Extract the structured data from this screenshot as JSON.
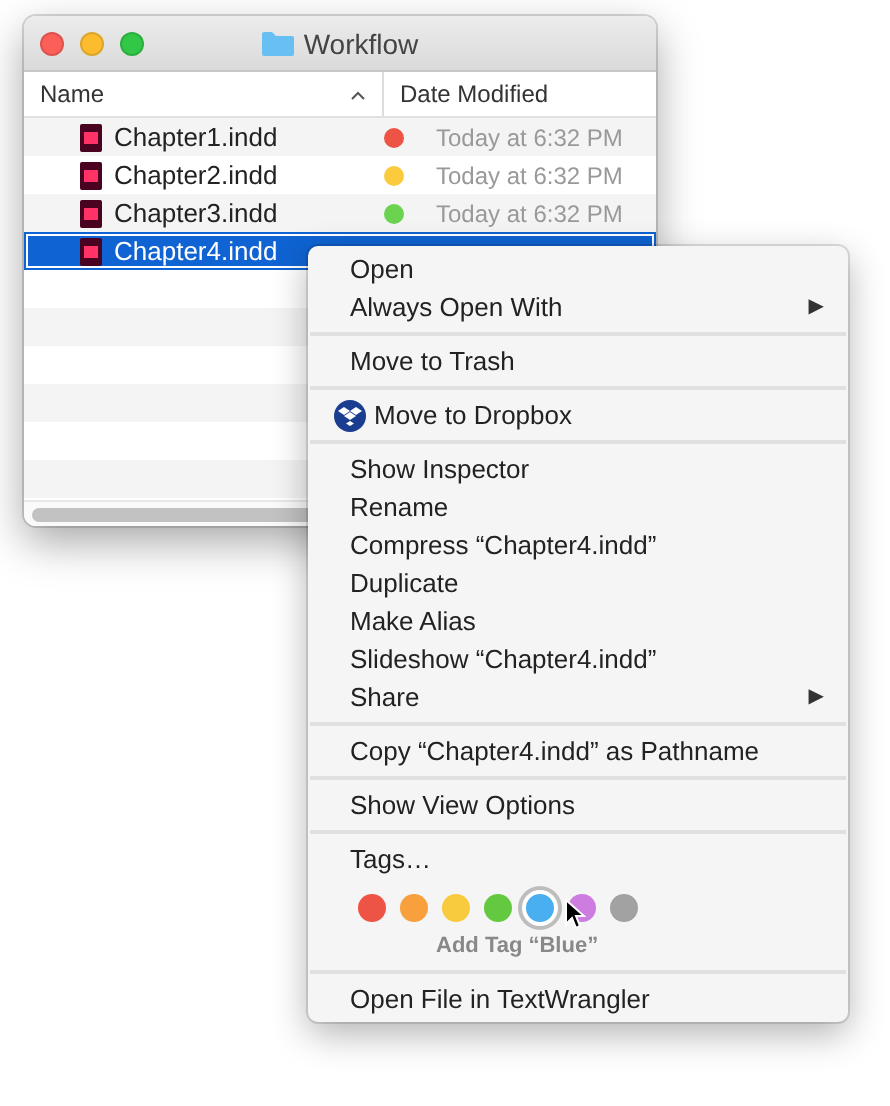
{
  "window": {
    "title": "Workflow"
  },
  "columns": [
    {
      "label": "Name",
      "sorted": true
    },
    {
      "label": "Date Modified",
      "sorted": false
    }
  ],
  "files": [
    {
      "name": "Chapter1.indd",
      "color": "#ee5446",
      "date": "Today at 6:32 PM",
      "selected": false
    },
    {
      "name": "Chapter2.indd",
      "color": "#fbcb3d",
      "date": "Today at 6:32 PM",
      "selected": false
    },
    {
      "name": "Chapter3.indd",
      "color": "#6bd34f",
      "date": "Today at 6:32 PM",
      "selected": false
    },
    {
      "name": "Chapter4.indd",
      "selected": true
    }
  ],
  "menu": {
    "sections": [
      [
        {
          "kind": "plain",
          "label": "Open"
        },
        {
          "kind": "submenu",
          "label": "Always Open With",
          "arrow": "▶"
        }
      ],
      [
        {
          "kind": "plain",
          "label": "Move to Trash"
        }
      ],
      [
        {
          "kind": "dropbox",
          "label": "Move to Dropbox"
        }
      ],
      [
        {
          "kind": "plain",
          "label": "Show Inspector"
        },
        {
          "kind": "plain",
          "label": "Rename"
        },
        {
          "kind": "plain",
          "label": "Compress “Chapter4.indd”"
        },
        {
          "kind": "plain",
          "label": "Duplicate"
        },
        {
          "kind": "plain",
          "label": "Make Alias"
        },
        {
          "kind": "plain",
          "label": "Slideshow “Chapter4.indd”"
        },
        {
          "kind": "submenu",
          "label": "Share",
          "arrow": "▶"
        }
      ],
      [
        {
          "kind": "plain",
          "label": "Copy “Chapter4.indd” as Pathname"
        }
      ],
      [
        {
          "kind": "plain",
          "label": "Show View Options"
        }
      ],
      [
        {
          "kind": "plain",
          "label": "Tags…"
        },
        {
          "kind": "tags",
          "colors": [
            {
              "color": "#ee5446",
              "selected": false
            },
            {
              "color": "#f7a03d",
              "selected": false
            },
            {
              "color": "#f8cb3e",
              "selected": false
            },
            {
              "color": "#64c940",
              "selected": false
            },
            {
              "color": "#4aaff0",
              "selected": true
            },
            {
              "color": "#cd7ce0",
              "selected": false
            },
            {
              "color": "#a2a2a2",
              "selected": false
            }
          ],
          "hint": "Add Tag “Blue”"
        }
      ],
      [
        {
          "kind": "plain",
          "label": "Open File in TextWrangler"
        }
      ]
    ]
  }
}
